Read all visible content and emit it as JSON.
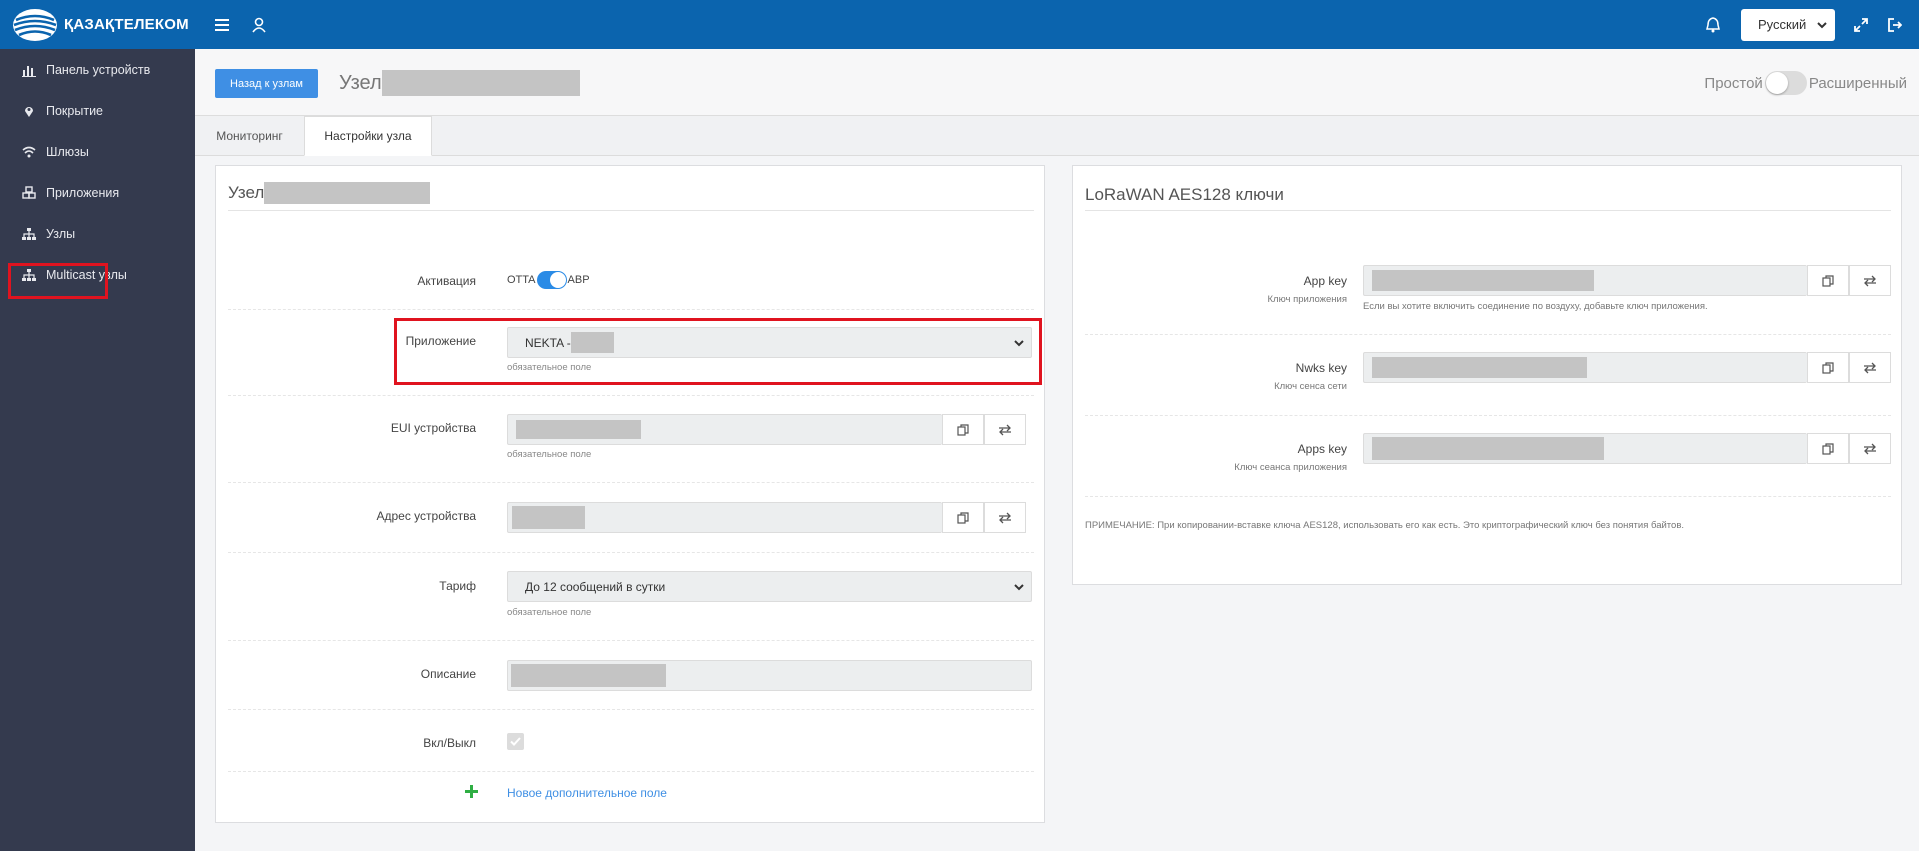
{
  "brand": {
    "name": "ҚАЗАҚТЕЛЕКОМ"
  },
  "topbar": {
    "language": "Русский"
  },
  "sidebar": {
    "items": [
      {
        "label": "Панель устройств",
        "icon": "bar-chart-icon"
      },
      {
        "label": "Покрытие",
        "icon": "map-pin-icon"
      },
      {
        "label": "Шлюзы",
        "icon": "wifi-icon"
      },
      {
        "label": "Приложения",
        "icon": "cubes-icon"
      },
      {
        "label": "Узлы",
        "icon": "sitemap-icon"
      },
      {
        "label": "Multicast узлы",
        "icon": "sitemap-icon"
      }
    ]
  },
  "header": {
    "back_label": "Назад к узлам",
    "title": "Узел",
    "mode_simple": "Простой",
    "mode_advanced": "Расширенный"
  },
  "tabs": [
    {
      "label": "Мониторинг"
    },
    {
      "label": "Настройки узла"
    }
  ],
  "node_panel": {
    "title": "Узел",
    "activation": {
      "label": "Активация",
      "otta": "OTTA",
      "abp": "ABP"
    },
    "application": {
      "label": "Приложение",
      "value": "NEKTA - ",
      "hint": "обязательное поле"
    },
    "eui": {
      "label": "EUI устройства",
      "hint": "обязательное поле"
    },
    "address": {
      "label": "Адрес устройства"
    },
    "tariff": {
      "label": "Тариф",
      "value": "До 12 сообщений в сутки",
      "hint": "обязательное поле"
    },
    "description": {
      "label": "Описание"
    },
    "enabled": {
      "label": "Вкл/Выкл"
    },
    "add_field": {
      "label": "Новое дополнительное поле"
    }
  },
  "keys_panel": {
    "title": "LoRaWAN AES128 ключи",
    "app_key": {
      "label": "App key",
      "sublabel": "Ключ приложения",
      "hint": "Если вы хотите включить соединение по воздуху, добавьте ключ приложения."
    },
    "nwks_key": {
      "label": "Nwks key",
      "sublabel": "Ключ сенса сети"
    },
    "apps_key": {
      "label": "Apps key",
      "sublabel": "Ключ сеанса приложения"
    },
    "note": "ПРИМЕЧАНИЕ: При копировании-вставке ключа AES128, использовать его как есть. Это криптографический ключ без понятия байтов."
  },
  "colors": {
    "topbar": "#0b64ae",
    "sidebar": "#343a4e",
    "accent": "#3f8fe4",
    "highlight": "#e0131f"
  }
}
